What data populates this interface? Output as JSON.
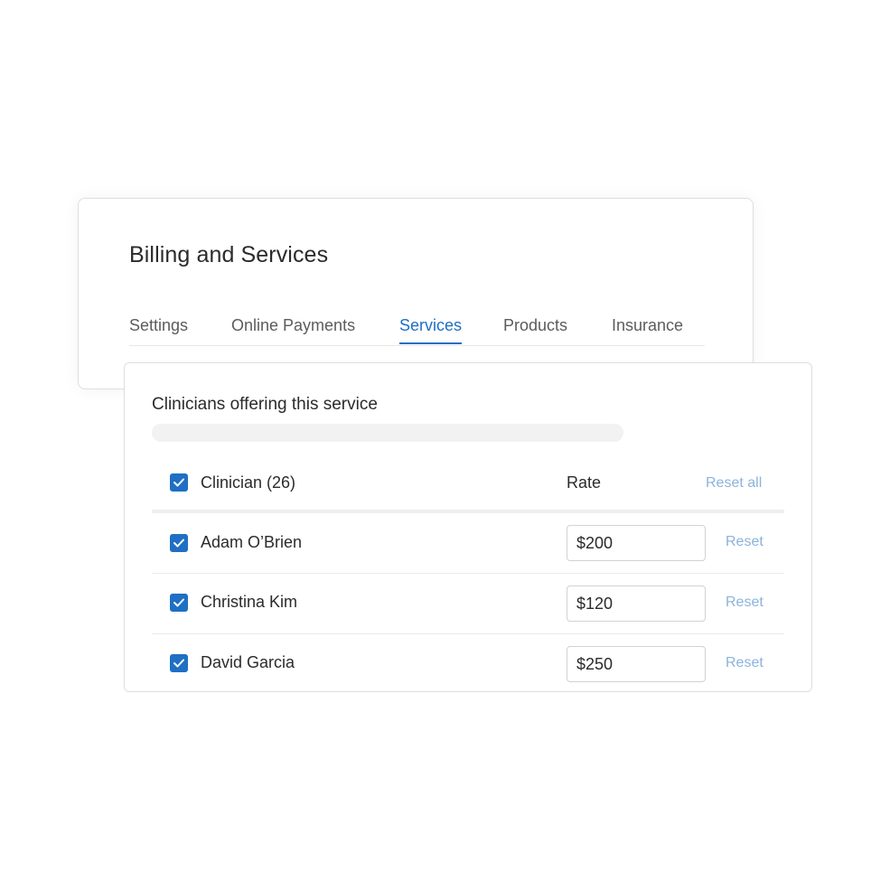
{
  "page": {
    "title": "Billing and Services"
  },
  "tabs": [
    {
      "label": "Settings",
      "active": false
    },
    {
      "label": "Online Payments",
      "active": false
    },
    {
      "label": "Services",
      "active": true
    },
    {
      "label": "Products",
      "active": false
    },
    {
      "label": "Insurance",
      "active": false
    }
  ],
  "clinicians_section": {
    "title": "Clinicians offering this service",
    "header": {
      "clinician_label": "Clinician (26)",
      "rate_label": "Rate",
      "reset_all_label": "Reset all",
      "checked": true
    },
    "rows": [
      {
        "name": "Adam O’Brien",
        "rate": "$200",
        "reset_label": "Reset",
        "checked": true
      },
      {
        "name": "Christina Kim",
        "rate": "$120",
        "reset_label": "Reset",
        "checked": true
      },
      {
        "name": "David Garcia",
        "rate": "$250",
        "reset_label": "Reset",
        "checked": true
      }
    ]
  },
  "colors": {
    "accent": "#1f6fc4",
    "link_muted": "#8db3dc",
    "text": "#2b2b2b",
    "tab_inactive": "#5c5c5c",
    "border": "#dedede"
  },
  "icons": {
    "checkbox": "checkmark-icon"
  }
}
